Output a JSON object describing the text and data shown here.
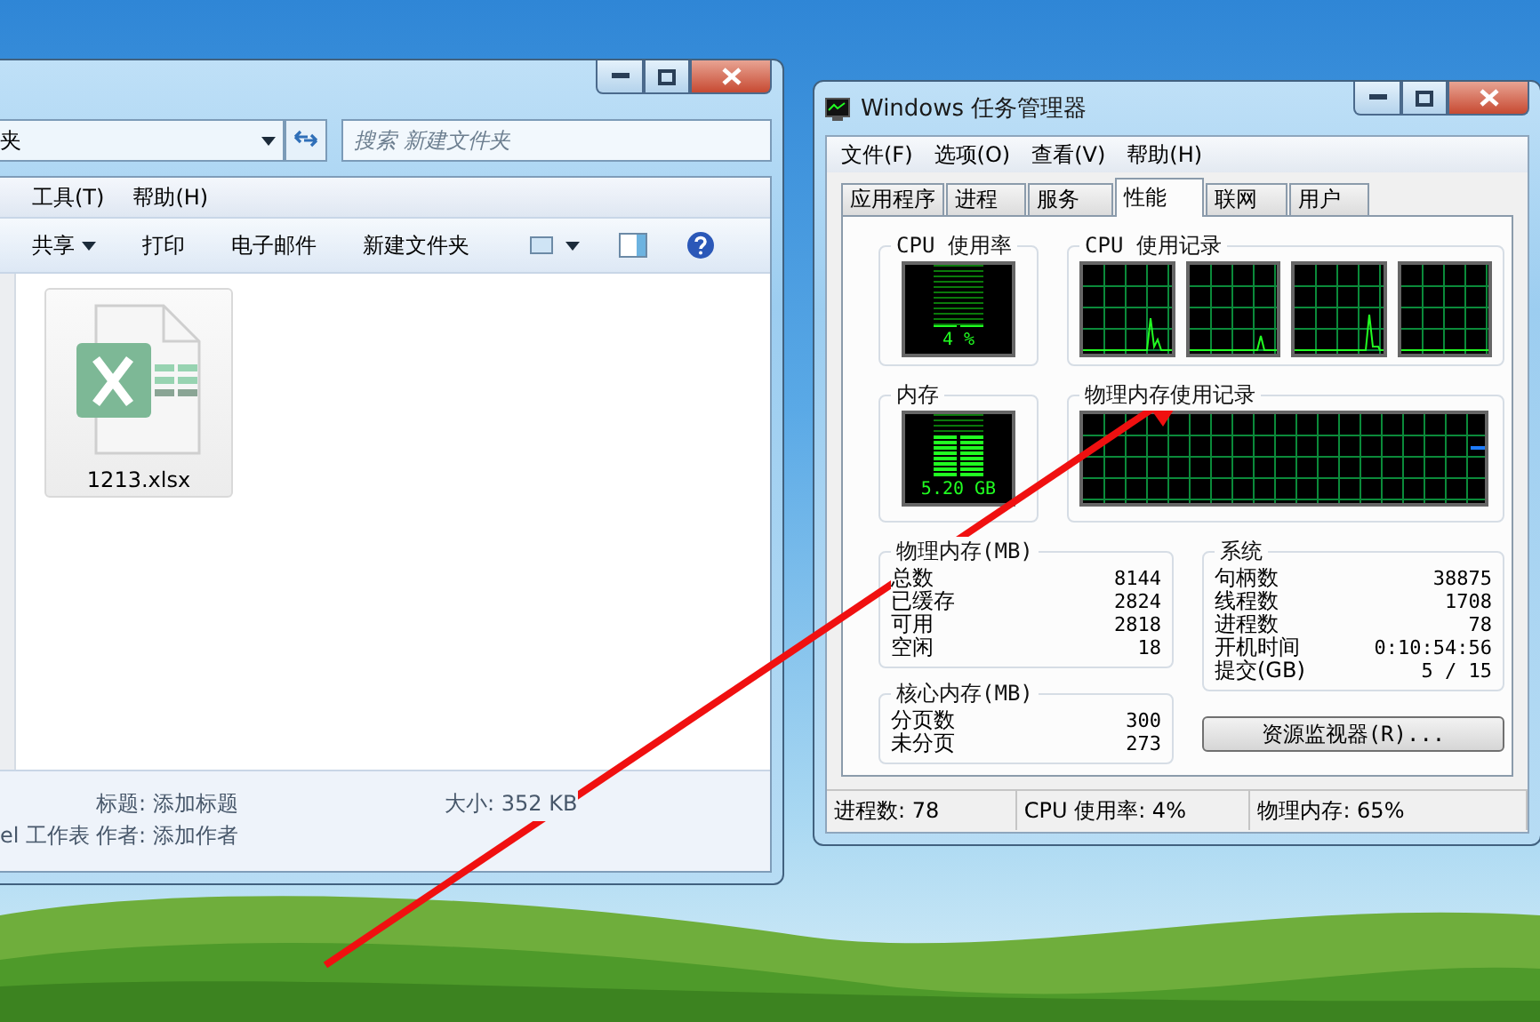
{
  "explorer": {
    "address": "夹",
    "search_placeholder": "搜索 新建文件夹",
    "menu": [
      "工具(T)",
      "帮助(H)"
    ],
    "toolbar": [
      {
        "label": "共享",
        "dropdown": true
      },
      {
        "label": "打印",
        "dropdown": false
      },
      {
        "label": "电子邮件",
        "dropdown": false
      },
      {
        "label": "新建文件夹",
        "dropdown": false
      }
    ],
    "files": [
      {
        "name": "1213.xlsx"
      }
    ],
    "details": {
      "type": "el 工作表",
      "title": "标题: 添加标题",
      "author": "作者: 添加作者",
      "size": "大小: 352 KB"
    }
  },
  "task_manager": {
    "title": "Windows 任务管理器",
    "menu": [
      "文件(F)",
      "选项(O)",
      "查看(V)",
      "帮助(H)"
    ],
    "tabs": [
      {
        "label": "应用程序",
        "selected": false
      },
      {
        "label": "进程",
        "selected": false
      },
      {
        "label": "服务",
        "selected": false
      },
      {
        "label": "性能",
        "selected": true
      },
      {
        "label": "联网",
        "selected": false
      },
      {
        "label": "用户",
        "selected": false
      }
    ],
    "cpu_usage": {
      "title": "CPU 使用率",
      "reading": "4 %",
      "level": 0.04
    },
    "cpu_history": {
      "title": "CPU 使用记录"
    },
    "memory": {
      "title": "内存",
      "reading": "5.20 GB",
      "level": 0.65
    },
    "memory_history": {
      "title": "物理内存使用记录"
    },
    "physical_memory": {
      "title": "物理内存(MB)",
      "rows": [
        {
          "label": "总数",
          "value": "8144"
        },
        {
          "label": "已缓存",
          "value": "2824"
        },
        {
          "label": "可用",
          "value": "2818"
        },
        {
          "label": "空闲",
          "value": "18"
        }
      ]
    },
    "kernel_memory": {
      "title": "核心内存(MB)",
      "rows": [
        {
          "label": "分页数",
          "value": "300"
        },
        {
          "label": "未分页",
          "value": "273"
        }
      ]
    },
    "system": {
      "title": "系统",
      "rows": [
        {
          "label": "句柄数",
          "value": "38875"
        },
        {
          "label": "线程数",
          "value": "1708"
        },
        {
          "label": "进程数",
          "value": "78"
        },
        {
          "label": "开机时间",
          "value": "0:10:54:56"
        },
        {
          "label": "提交(GB)",
          "value": "5 / 15"
        }
      ]
    },
    "resource_button": "资源监视器(R)...",
    "status_bar": [
      "进程数: 78",
      "CPU 使用率: 4%",
      "物理内存: 65%"
    ]
  }
}
